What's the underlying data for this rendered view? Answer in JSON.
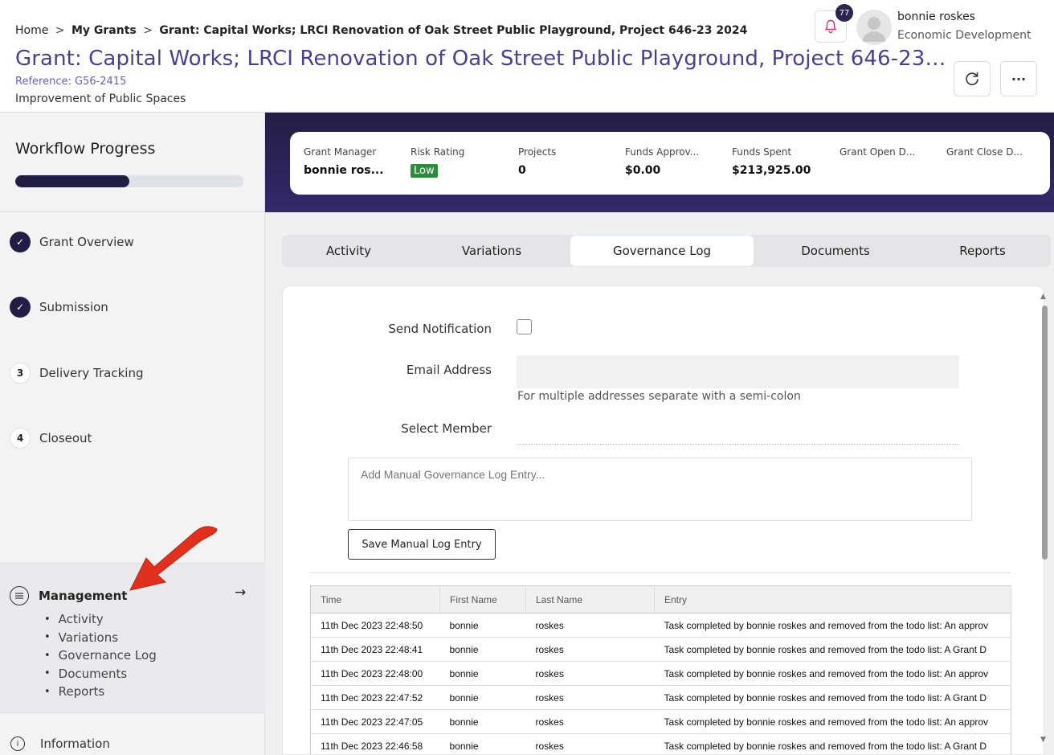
{
  "breadcrumb": {
    "home": "Home",
    "sep": ">",
    "my_grants": "My Grants",
    "current": "Grant: Capital Works; LRCI Renovation of Oak Street Public Playground, Project 646-23 2024"
  },
  "page": {
    "title": "Grant: Capital Works; LRCI Renovation of Oak Street Public Playground, Project 646-23 2024",
    "reference": "Reference: G56-2415",
    "subtitle": "Improvement of Public Spaces"
  },
  "user": {
    "notification_count": "77",
    "name": "bonnie roskes",
    "department": "Economic Development"
  },
  "header_actions": {
    "refresh_icon": "refresh-icon",
    "more_label": "···"
  },
  "workflow": {
    "title": "Workflow Progress",
    "progress_fraction": 0.5,
    "steps": [
      {
        "marker": "✓",
        "label": "Grant Overview",
        "state": "done"
      },
      {
        "marker": "✓",
        "label": "Submission",
        "state": "done"
      },
      {
        "marker": "3",
        "label": "Delivery Tracking",
        "state": "pending"
      },
      {
        "marker": "4",
        "label": "Closeout",
        "state": "pending"
      }
    ]
  },
  "management": {
    "label": "Management",
    "arrow": "→",
    "items": [
      "Activity",
      "Variations",
      "Governance Log",
      "Documents",
      "Reports"
    ]
  },
  "information": {
    "label": "Information"
  },
  "stats": [
    {
      "label": "Grant Manager",
      "value": "bonnie ros..."
    },
    {
      "label": "Risk Rating",
      "value": "Low"
    },
    {
      "label": "Projects",
      "value": "0"
    },
    {
      "label": "Funds Approv...",
      "value": "$0.00"
    },
    {
      "label": "Funds Spent",
      "value": "$213,925.00"
    },
    {
      "label": "Grant Open D...",
      "value": ""
    },
    {
      "label": "Grant Close D...",
      "value": ""
    }
  ],
  "tabs": [
    "Activity",
    "Variations",
    "Governance Log",
    "Documents",
    "Reports"
  ],
  "active_tab": "Governance Log",
  "form": {
    "send_notification_label": "Send Notification",
    "email_label": "Email Address",
    "email_help": "For multiple addresses separate with a semi-colon",
    "member_label": "Select Member",
    "manual_placeholder": "Add Manual Governance Log Entry...",
    "save_label": "Save Manual Log Entry"
  },
  "log_table": {
    "headers": [
      "Time",
      "First Name",
      "Last Name",
      "Entry"
    ],
    "rows": [
      [
        "11th Dec 2023 22:48:50",
        "bonnie",
        "roskes",
        "Task completed by bonnie roskes and removed from the todo list: An approv"
      ],
      [
        "11th Dec 2023 22:48:41",
        "bonnie",
        "roskes",
        "Task completed by bonnie roskes and removed from the todo list: A Grant D"
      ],
      [
        "11th Dec 2023 22:48:00",
        "bonnie",
        "roskes",
        "Task completed by bonnie roskes and removed from the todo list: An approv"
      ],
      [
        "11th Dec 2023 22:47:52",
        "bonnie",
        "roskes",
        "Task completed by bonnie roskes and removed from the todo list: A Grant D"
      ],
      [
        "11th Dec 2023 22:47:05",
        "bonnie",
        "roskes",
        "Task completed by bonnie roskes and removed from the todo list: An approv"
      ],
      [
        "11th Dec 2023 22:46:58",
        "bonnie",
        "roskes",
        "Task completed by bonnie roskes and removed from the todo list: A Grant D"
      ]
    ]
  },
  "colors": {
    "brand": "#221d45",
    "title": "#4b3f8f",
    "risk_low": "#2e8b3e",
    "annotation_arrow": "#e0301e"
  }
}
